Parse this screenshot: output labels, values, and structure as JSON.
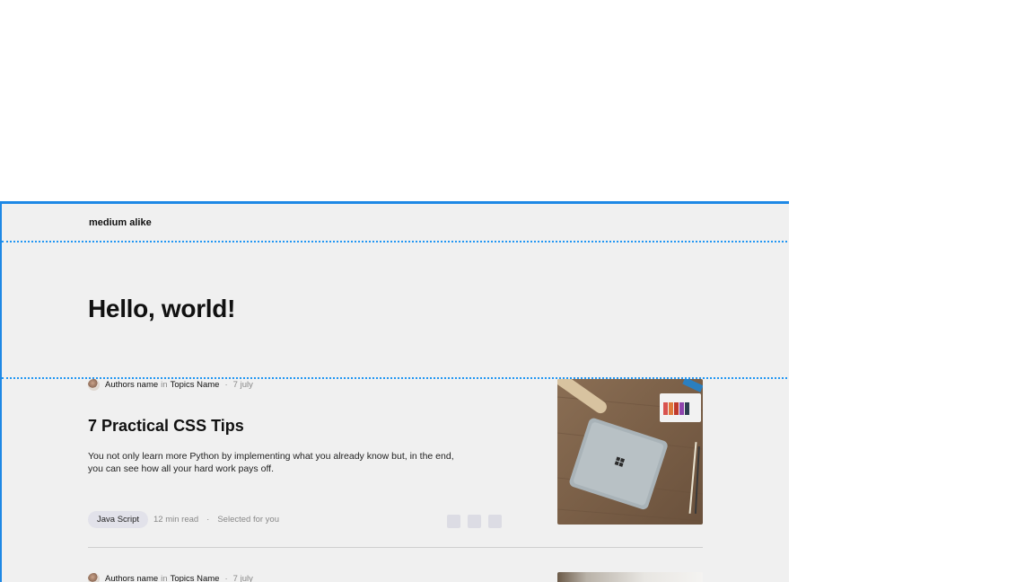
{
  "header": {
    "brand": "medium alike"
  },
  "hero": {
    "title": "Hello, world!"
  },
  "articles": [
    {
      "author": "Authors name",
      "in_word": "in",
      "topic": "Topics Name",
      "dot": "·",
      "date": "7 july",
      "title": "7 Practical CSS Tips",
      "excerpt": "You not only learn more Python by implementing what you already know but, in the end, you can see how all your hard work pays off.",
      "tag": "Java Script",
      "read_time": "12 min read",
      "dot2": "·",
      "note": "Selected for you",
      "thumbnail_icon": "laptop-desk-photo"
    },
    {
      "author": "Authors name",
      "in_word": "in",
      "topic": "Topics Name",
      "dot": "·",
      "date": "7 july",
      "thumbnail_icon": "room-photo"
    }
  ],
  "colors": {
    "frame_border": "#1e88e5",
    "guide_line": "#2196f3",
    "background": "#f0f0f0",
    "tag_bg": "#e2e2ea"
  }
}
